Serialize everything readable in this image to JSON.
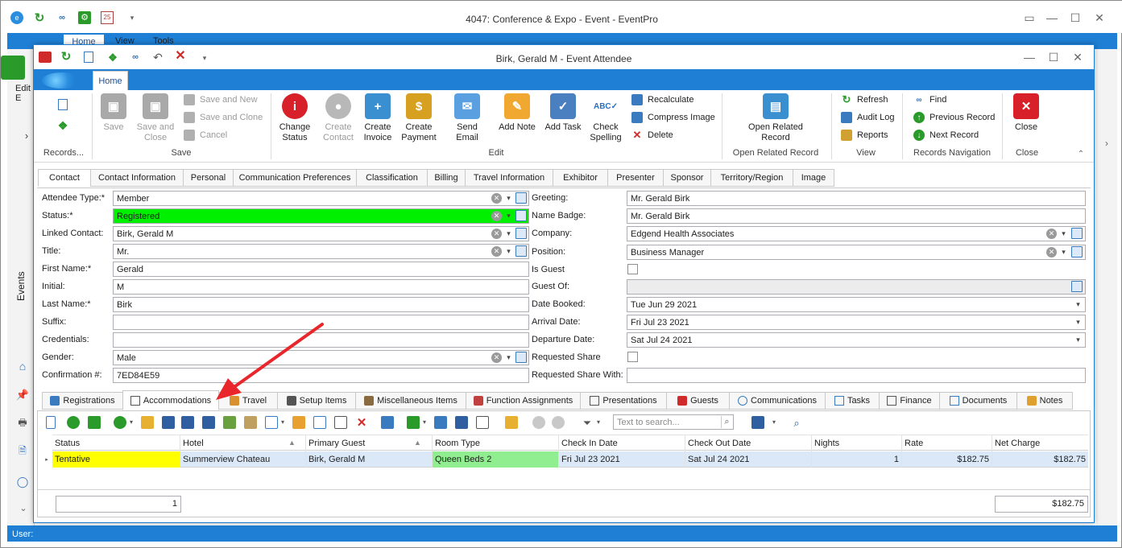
{
  "outer_window": {
    "title": "4047: Conference & Expo - Event - EventPro",
    "tabs": [
      "Home",
      "View",
      "Tools"
    ],
    "ribbon_partial_label": "Edit E",
    "side_label": "Events",
    "status_text": "User:"
  },
  "inner_window": {
    "title": "Birk, Gerald M - Event Attendee",
    "ribbon_tab": "Home"
  },
  "ribbon": {
    "records": {
      "label": "Records..."
    },
    "save": {
      "group": "Save",
      "save": "Save",
      "save_and_close": "Save and Close",
      "save_and_new": "Save and New",
      "save_and_clone": "Save and Clone",
      "cancel": "Cancel"
    },
    "edit": {
      "group": "Edit",
      "change_status": "Change Status",
      "create_contact": "Create Contact",
      "create_invoice": "Create Invoice",
      "create_payment": "Create Payment",
      "send_email": "Send Email",
      "add_note": "Add Note",
      "add_task": "Add Task",
      "check_spelling": "Check Spelling",
      "recalculate": "Recalculate",
      "compress_image": "Compress Image",
      "delete": "Delete"
    },
    "open_related": {
      "group": "Open Related Record",
      "button": "Open Related Record"
    },
    "view": {
      "group": "View",
      "refresh": "Refresh",
      "audit_log": "Audit Log",
      "reports": "Reports"
    },
    "nav": {
      "group": "Records Navigation",
      "find": "Find",
      "previous": "Previous Record",
      "next": "Next Record"
    },
    "close": {
      "group": "Close",
      "button": "Close"
    }
  },
  "top_tabs": [
    "Contact",
    "Contact Information",
    "Personal",
    "Communication Preferences",
    "Classification",
    "Billing",
    "Travel Information",
    "Exhibitor",
    "Presenter",
    "Sponsor",
    "Territory/Region",
    "Image"
  ],
  "form_left": {
    "attendee_type": {
      "label": "Attendee Type:*",
      "value": "Member"
    },
    "status": {
      "label": "Status:*",
      "value": "Registered"
    },
    "linked_contact": {
      "label": "Linked Contact:",
      "value": "Birk, Gerald M"
    },
    "title": {
      "label": "Title:",
      "value": "Mr."
    },
    "first_name": {
      "label": "First Name:*",
      "value": "Gerald"
    },
    "initial": {
      "label": "Initial:",
      "value": "M"
    },
    "last_name": {
      "label": "Last Name:*",
      "value": "Birk"
    },
    "suffix": {
      "label": "Suffix:",
      "value": ""
    },
    "credentials": {
      "label": "Credentials:",
      "value": ""
    },
    "gender": {
      "label": "Gender:",
      "value": "Male"
    },
    "confirmation": {
      "label": "Confirmation #:",
      "value": "7ED84E59"
    }
  },
  "form_right": {
    "greeting": {
      "label": "Greeting:",
      "value": "Mr. Gerald Birk"
    },
    "name_badge": {
      "label": "Name Badge:",
      "value": "Mr. Gerald Birk"
    },
    "company": {
      "label": "Company:",
      "value": "Edgend Health Associates"
    },
    "position": {
      "label": "Position:",
      "value": "Business Manager"
    },
    "is_guest": {
      "label": "Is Guest"
    },
    "guest_of": {
      "label": "Guest Of:",
      "value": ""
    },
    "date_booked": {
      "label": "Date Booked:",
      "value": "Tue Jun 29 2021"
    },
    "arrival_date": {
      "label": "Arrival Date:",
      "value": "Fri Jul 23 2021"
    },
    "departure_date": {
      "label": "Departure Date:",
      "value": "Sat Jul 24 2021"
    },
    "requested_share": {
      "label": "Requested Share"
    },
    "requested_share_with": {
      "label": "Requested Share With:",
      "value": ""
    }
  },
  "bottom_tabs": [
    "Registrations",
    "Accommodations",
    "Travel",
    "Setup Items",
    "Miscellaneous Items",
    "Function Assignments",
    "Presentations",
    "Guests",
    "Communications",
    "Tasks",
    "Finance",
    "Documents",
    "Notes"
  ],
  "grid_toolbar": {
    "search_placeholder": "Text to search..."
  },
  "grid": {
    "columns": [
      "Status",
      "Hotel",
      "Primary Guest",
      "Room Type",
      "Check In Date",
      "Check Out Date",
      "Nights",
      "Rate",
      "Net Charge"
    ],
    "rows": [
      {
        "status": "Tentative",
        "hotel": "Summerview Chateau",
        "primary_guest": "Birk, Gerald M",
        "room_type": "Queen Beds 2",
        "check_in": "Fri Jul 23 2021",
        "check_out": "Sat Jul 24 2021",
        "nights": "1",
        "rate": "$182.75",
        "net_charge": "$182.75"
      }
    ],
    "footer_count": "1",
    "footer_total": "$182.75"
  },
  "colors": {
    "accent": "#1f7fd4",
    "status_registered": "#00f000",
    "status_tentative": "#ffff00",
    "room_type": "#90ee90",
    "selected_row": "#dbe8f7",
    "arrow": "#e8262b"
  }
}
